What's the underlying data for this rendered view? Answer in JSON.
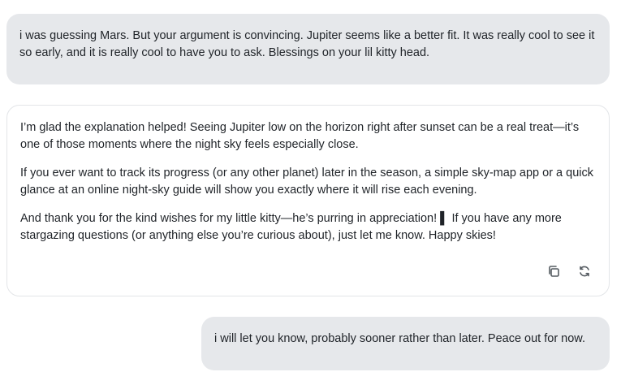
{
  "conversation": {
    "user_message_1": "i was guessing Mars. But your argument is convincing. Jupiter seems like a better fit. It was really cool to see it so early, and it is really cool to have you to ask. Blessings on your lil kitty head.",
    "assistant_message": {
      "paragraphs": [
        "I’m glad the explanation helped! Seeing Jupiter low on the horizon right after sunset can be a real treat—it’s one of those moments where the night sky feels especially close.",
        "If you ever want to track its progress (or any other planet) later in the season, a simple sky-map app or a quick glance at an online night-sky guide will show you exactly where it will rise each evening.",
        "And thank you for the kind wishes for my little kitty—he’s purring in appreciation! ▌ If you have any more stargazing questions (or anything else you’re curious about), just let me know. Happy skies!"
      ],
      "actions": {
        "copy_icon": "copy-icon",
        "regenerate_icon": "refresh-icon"
      }
    },
    "user_message_2": "i will let you know, probably sooner rather than later. Peace out for now."
  }
}
